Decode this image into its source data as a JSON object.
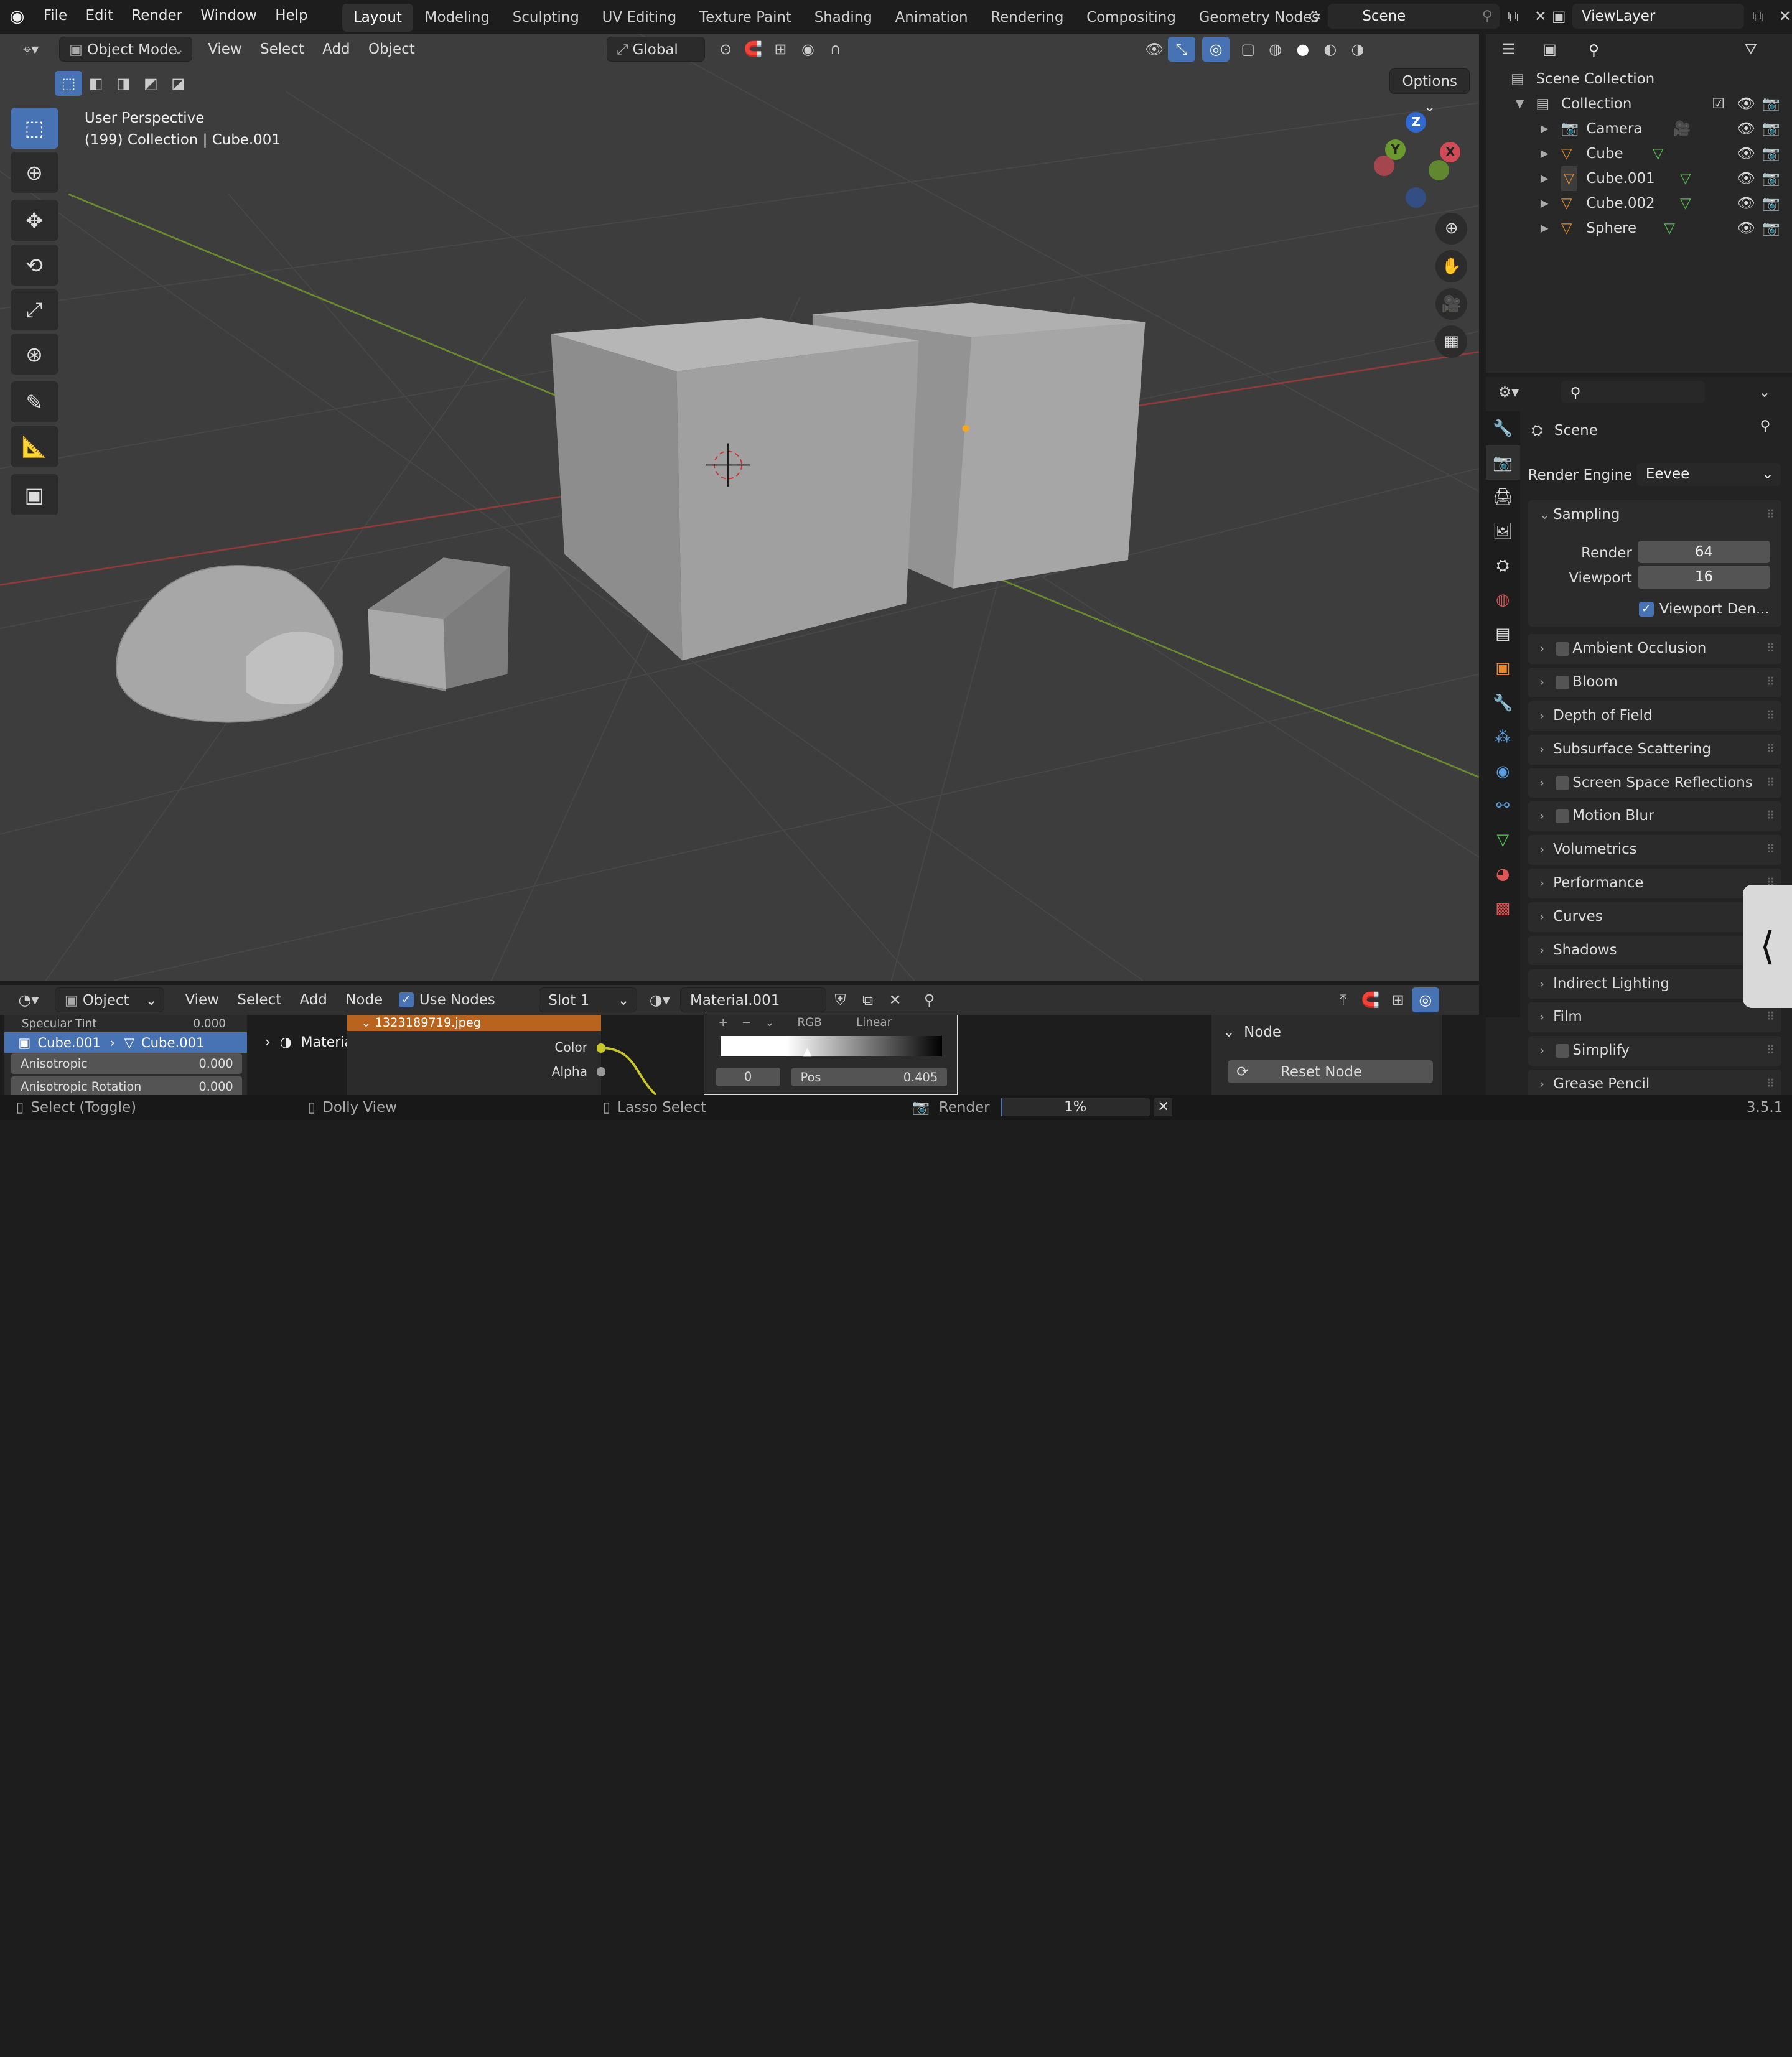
{
  "topbar": {
    "menus": [
      "File",
      "Edit",
      "Render",
      "Window",
      "Help"
    ],
    "workspaces": [
      "Layout",
      "Modeling",
      "Sculpting",
      "UV Editing",
      "Texture Paint",
      "Shading",
      "Animation",
      "Rendering",
      "Compositing",
      "Geometry Nodes"
    ],
    "active_workspace": "Layout",
    "scene": "Scene",
    "view_layer": "ViewLayer"
  },
  "viewport": {
    "mode": "Object Mode",
    "menus": [
      "View",
      "Select",
      "Add",
      "Object"
    ],
    "transform": "Global",
    "options": "Options",
    "overlay_title": "User Perspective",
    "overlay_subtitle": "(199) Collection | Cube.001",
    "axes": {
      "z": "Z",
      "y": "Y",
      "x": "X"
    }
  },
  "outliner": {
    "scene_collection": "Scene Collection",
    "collection": "Collection",
    "items": [
      {
        "name": "Camera",
        "icon": "camera-icon"
      },
      {
        "name": "Cube",
        "icon": "mesh-icon"
      },
      {
        "name": "Cube.001",
        "icon": "mesh-icon"
      },
      {
        "name": "Cube.002",
        "icon": "mesh-icon"
      },
      {
        "name": "Sphere",
        "icon": "mesh-icon"
      }
    ]
  },
  "properties": {
    "context": "Scene",
    "render_engine_label": "Render Engine",
    "render_engine": "Eevee",
    "sampling": {
      "label": "Sampling",
      "render_label": "Render",
      "render": "64",
      "viewport_label": "Viewport",
      "viewport": "16",
      "denoise": "Viewport Den..."
    },
    "panels": [
      {
        "label": "Ambient Occlusion",
        "checkbox": true
      },
      {
        "label": "Bloom",
        "checkbox": true
      },
      {
        "label": "Depth of Field",
        "checkbox": false
      },
      {
        "label": "Subsurface Scattering",
        "checkbox": false
      },
      {
        "label": "Screen Space Reflections",
        "checkbox": true
      },
      {
        "label": "Motion Blur",
        "checkbox": true
      },
      {
        "label": "Volumetrics",
        "checkbox": false
      },
      {
        "label": "Performance",
        "checkbox": false
      },
      {
        "label": "Curves",
        "checkbox": false
      },
      {
        "label": "Shadows",
        "checkbox": false
      },
      {
        "label": "Indirect Lighting",
        "checkbox": false
      },
      {
        "label": "Film",
        "checkbox": false
      },
      {
        "label": "Simplify",
        "checkbox": true
      },
      {
        "label": "Grease Pencil",
        "checkbox": false
      }
    ]
  },
  "node_editor": {
    "type": "Object",
    "menus": [
      "View",
      "Select",
      "Add",
      "Node"
    ],
    "use_nodes": "Use Nodes",
    "slot": "Slot 1",
    "material": "Material.001",
    "breadcrumb": [
      "Cube.001",
      "Cube.001",
      "Material.001"
    ],
    "left_props": [
      {
        "label": "Specular Tint",
        "value": "0.000"
      },
      {
        "label": "Anisotropic",
        "value": "0.000"
      },
      {
        "label": "Anisotropic Rotation",
        "value": "0.000"
      }
    ],
    "image_node": "1323189719.jpeg",
    "sockets": [
      "Color",
      "Alpha"
    ],
    "ramp": {
      "mode": "RGB",
      "interp": "Linear",
      "index": "0",
      "pos_label": "Pos",
      "pos": "0.405"
    },
    "side_panel": {
      "title": "Node",
      "reset": "Reset Node"
    }
  },
  "statusbar": {
    "select": "Select (Toggle)",
    "dolly": "Dolly View",
    "lasso": "Lasso Select",
    "render": "Render",
    "progress": "1%",
    "progress_value": 0.01,
    "version": "3.5.1"
  }
}
